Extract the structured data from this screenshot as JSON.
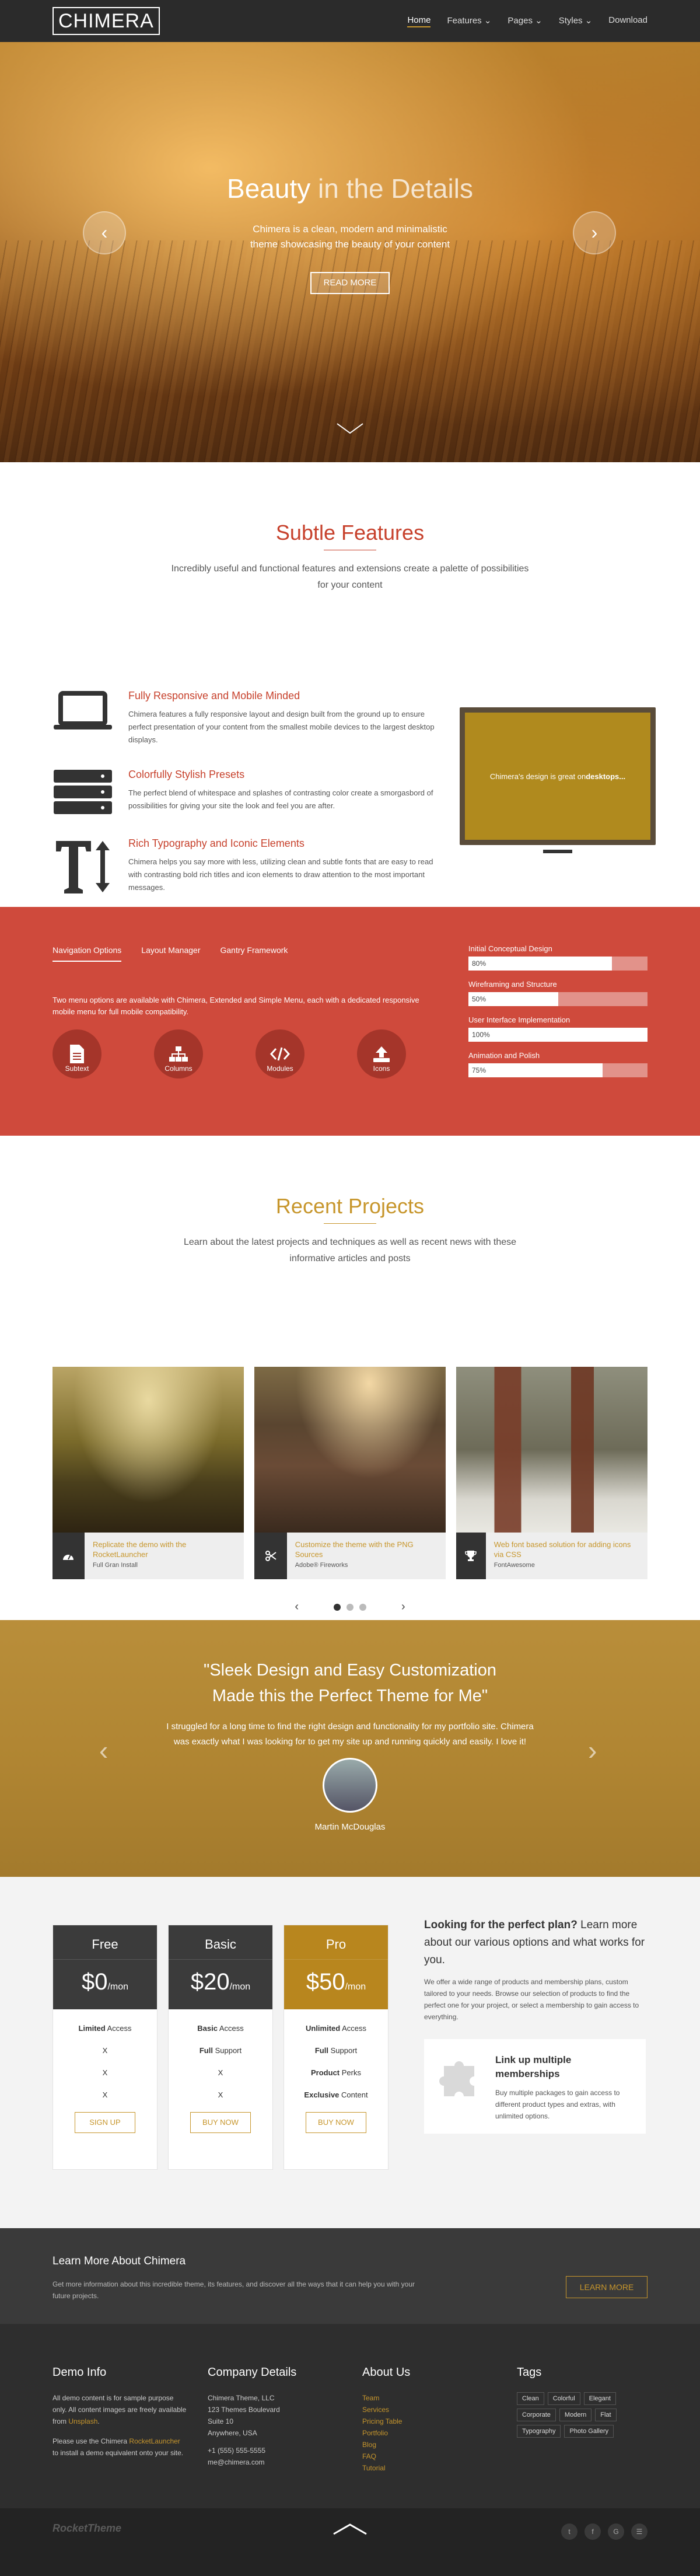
{
  "header": {
    "logo": "CHIMERA",
    "nav": [
      {
        "label": "Home",
        "active": true
      },
      {
        "label": "Features ⌄"
      },
      {
        "label": "Pages ⌄"
      },
      {
        "label": "Styles ⌄"
      },
      {
        "label": "Download"
      }
    ]
  },
  "hero": {
    "title_a": "Beauty",
    "title_b": "in the Details",
    "sub1": "Chimera is a clean, modern and minimalistic",
    "sub2": "theme showcasing the beauty of your content",
    "button": "READ MORE"
  },
  "features": {
    "title_a": "Subtle",
    "title_b": "Features",
    "sub": "Incredibly useful and functional features and extensions create a palette of possibilities for your content",
    "items": [
      {
        "title": "Fully Responsive and Mobile Minded",
        "text": "Chimera features a fully responsive layout and design built from the ground up to ensure perfect presentation of your content from the smallest mobile devices to the largest desktop displays.",
        "icon": "laptop-icon"
      },
      {
        "title": "Colorfully Stylish Presets",
        "text": "The perfect blend of whitespace and splashes of contrasting color create a smorgasbord of possibilities for giving your site the look and feel you are after.",
        "icon": "server-stack-icon"
      },
      {
        "title": "Rich Typography and Iconic Elements",
        "text": "Chimera helps you say more with less, utilizing clean and subtle fonts that are easy to read with contrasting bold rich titles and icon elements to draw attention to the most important messages.",
        "icon": "text-height-icon"
      }
    ],
    "monitor_text_a": "Chimera's design is great on ",
    "monitor_text_b": "desktops..."
  },
  "tabs": {
    "items": [
      "Navigation Options",
      "Layout Manager",
      "Gantry Framework"
    ],
    "text": "Two menu options are available with Chimera, Extended and Simple Menu, each with a dedicated responsive mobile menu for full mobile compatibility.",
    "circles": [
      {
        "label": "Subtext",
        "icon": "document-icon"
      },
      {
        "label": "Columns",
        "icon": "sitemap-icon"
      },
      {
        "label": "Modules",
        "icon": "code-icon"
      },
      {
        "label": "Icons",
        "icon": "upload-icon"
      }
    ],
    "bars": [
      {
        "label": "Initial Conceptual Design",
        "value": 80,
        "text": "80%"
      },
      {
        "label": "Wireframing and Structure",
        "value": 50,
        "text": "50%"
      },
      {
        "label": "User Interface Implementation",
        "value": 100,
        "text": "100%"
      },
      {
        "label": "Animation and Polish",
        "value": 75,
        "text": "75%"
      }
    ]
  },
  "projects": {
    "title_a": "Recent",
    "title_b": "Projects",
    "sub": "Learn about the latest projects and techniques as well as recent news with these informative articles and posts",
    "cards": [
      {
        "title": "Replicate the demo with the RocketLauncher",
        "meta": "Full Gran Install",
        "icon": "dashboard-icon"
      },
      {
        "title": "Customize the theme with the PNG Sources",
        "meta": "Adobe® Fireworks",
        "icon": "scissors-icon"
      },
      {
        "title": "Web font based solution for adding icons via CSS",
        "meta": "FontAwesome",
        "icon": "trophy-icon"
      }
    ],
    "prev": "‹",
    "next": "›"
  },
  "testimonial": {
    "quote1": "\"Sleek Design and Easy Customization",
    "quote2": "Made this the Perfect Theme for Me\"",
    "body1": "I struggled for a long time to find the right design and functionality for my portfolio site. Chimera",
    "body2": "was exactly what I was looking for to get my site up and running quickly and easily. I love it!",
    "name": "Martin McDouglas",
    "prev": "‹",
    "next": "›"
  },
  "pricing": {
    "plans": [
      {
        "name": "Free",
        "price": "$0",
        "unit": "/mon",
        "color": "#3b3b3b",
        "rows": [
          [
            "Limited",
            " Access"
          ],
          [
            "X",
            ""
          ],
          [
            "X",
            ""
          ],
          [
            "X",
            ""
          ]
        ],
        "button": "SIGN UP"
      },
      {
        "name": "Basic",
        "price": "$20",
        "unit": "/mon",
        "color": "#3b3b3b",
        "rows": [
          [
            "Basic",
            " Access"
          ],
          [
            "Full",
            " Support"
          ],
          [
            "X",
            ""
          ],
          [
            "X",
            ""
          ]
        ],
        "button": "BUY NOW"
      },
      {
        "name": "Pro",
        "price": "$50",
        "unit": "/mon",
        "color": "#b8861e",
        "rows": [
          [
            "Unlimited",
            " Access"
          ],
          [
            "Full",
            " Support"
          ],
          [
            "Product",
            " Perks"
          ],
          [
            "Exclusive",
            " Content"
          ]
        ],
        "button": "BUY NOW"
      }
    ],
    "heading_bold": "Looking for the perfect plan?",
    "heading_rest": " Learn more about our various options and what works for you.",
    "text": "We offer a wide range of products and membership plans, custom tailored to your needs. Browse our selection of products to find the perfect one for your project, or select a membership to gain access to everything.",
    "box_title": "Link up multiple memberships",
    "box_text": "Buy multiple packages to gain access to different product types and extras, with unlimited options.",
    "box_icon": "puzzle-icon"
  },
  "learn": {
    "title": "Learn More About Chimera",
    "text": "Get more information about this incredible theme, its features, and discover all the ways that it can help you with your future projects.",
    "button": "LEARN MORE"
  },
  "footer": {
    "demo_title": "Demo Info",
    "demo_p1_a": "All demo content is for sample purpose only. All content images are freely available from ",
    "demo_p1_link": "Unsplash",
    "demo_p1_b": ".",
    "demo_p2_a": "Please use the Chimera ",
    "demo_p2_link": "RocketLauncher",
    "demo_p2_b": " to install a demo equivalent onto your site.",
    "company_title": "Company Details",
    "company_lines": [
      "Chimera Theme, LLC",
      "123 Themes Boulevard",
      "Suite 10",
      "Anywhere, USA",
      "",
      "+1 (555) 555-5555",
      "me@chimera.com"
    ],
    "about_title": "About Us",
    "about_links": [
      "Team",
      "Services",
      "Pricing Table",
      "Portfolio",
      "Blog",
      "FAQ",
      "Tutorial"
    ],
    "tags_title": "Tags",
    "tags": [
      "Clean",
      "Colorful",
      "Elegant",
      "Corporate",
      "Modern",
      "Flat",
      "Typography",
      "Photo Gallery"
    ],
    "brand": "RocketTheme",
    "social": [
      "t",
      "f",
      "G",
      "☰"
    ]
  }
}
